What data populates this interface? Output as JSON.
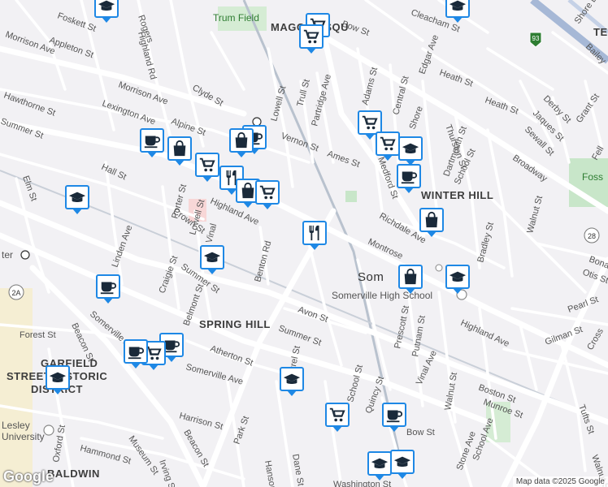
{
  "map": {
    "attribution": "Map data ©2025 Google",
    "logo": "Google",
    "neighborhoods": [
      {
        "id": "magoun-square",
        "text": "MAGOUN SQU"
      },
      {
        "id": "winter-hill",
        "text": "WINTER HILL"
      },
      {
        "id": "spring-hill",
        "text": "SPRING HILL"
      },
      {
        "id": "baldwin",
        "text": "BALDWIN"
      },
      {
        "id": "garfield-1",
        "text": "GARFIELD"
      },
      {
        "id": "garfield-2",
        "text": "STREET HISTORIC"
      },
      {
        "id": "garfield-3",
        "text": "DISTRICT"
      },
      {
        "id": "ten-hills",
        "text": "TE"
      },
      {
        "id": "foss",
        "text": "Foss"
      }
    ],
    "places": [
      {
        "id": "trum-field",
        "text": "Trum Field"
      },
      {
        "id": "somerville",
        "text": "Som"
      },
      {
        "id": "somerville-high",
        "text": "Somerville High School"
      },
      {
        "id": "lesley-1",
        "text": "Lesley"
      },
      {
        "id": "lesley-2",
        "text": "University"
      },
      {
        "id": "porter-station",
        "text": "ter"
      }
    ],
    "streets": [
      "Foskett St",
      "Rogers",
      "Highland Rd",
      "Appleton St",
      "Morrison Ave",
      "Bow St",
      "Cleacham St",
      "Edgar Ave",
      "Heath St",
      "Shore Dr",
      "Bailey",
      "Morrison Ave",
      "Clyde St",
      "Lowell St",
      "Trull St",
      "Partridge Ave",
      "Hawthorne St",
      "Lexington Ave",
      "Alpine St",
      "Vernon St",
      "Adams St",
      "Central St",
      "Ames St",
      "Medford St",
      "Shore",
      "Thurston St",
      "Dartmouth St",
      "School St",
      "Heath St",
      "Derby St",
      "Jaques St",
      "Sewall St",
      "Grant St",
      "Broadway",
      "Summer St",
      "Elm St",
      "Hall St",
      "Porter St",
      "Lowell St",
      "Vinal",
      "Crown St",
      "Highland Ave",
      "Richdale Ave",
      "Montrose",
      "Walnut St",
      "Bradley St",
      "Linden Ave",
      "Craigie St",
      "Summer St",
      "Belmont St",
      "Benton Rd",
      "Avon St",
      "Somerville Ave",
      "Beacon St",
      "Forest St",
      "Atherton St",
      "Summer St",
      "Laurel St",
      "Somerville Ave",
      "School St",
      "Quincy St",
      "Prescott St",
      "Putnam St",
      "Vinal Ave",
      "Highland Ave",
      "Walnut St",
      "Boston St",
      "Munroe St",
      "School Ave",
      "Stone Ave",
      "Pearl St",
      "Gilman St",
      "Cross",
      "Tufts St",
      "Otis St",
      "Bona",
      "Harrison St",
      "Museum St",
      "Hammond St",
      "Oxford St",
      "Beacon St",
      "Park St",
      "Irving St",
      "Dane St",
      "Hanson",
      "Bow St",
      "Washington St",
      "Walnut St",
      "Fell"
    ],
    "routes": [
      "93",
      "28",
      "2A"
    ],
    "markers": [
      {
        "type": "school",
        "icon": "school-icon"
      },
      {
        "type": "grocery",
        "icon": "cart-icon"
      },
      {
        "type": "grocery",
        "icon": "cart-icon"
      },
      {
        "type": "school",
        "icon": "school-icon"
      },
      {
        "type": "grocery",
        "icon": "cart-icon"
      },
      {
        "type": "cafe",
        "icon": "cafe-icon"
      },
      {
        "type": "cafe",
        "icon": "cafe-icon"
      },
      {
        "type": "store",
        "icon": "shopping-bag-icon"
      },
      {
        "type": "store",
        "icon": "shopping-bag-icon"
      },
      {
        "type": "grocery",
        "icon": "cart-icon"
      },
      {
        "type": "grocery",
        "icon": "cart-icon"
      },
      {
        "type": "school",
        "icon": "school-icon"
      },
      {
        "type": "restaurant",
        "icon": "restaurant-icon"
      },
      {
        "type": "store",
        "icon": "shopping-bag-icon"
      },
      {
        "type": "grocery",
        "icon": "cart-icon"
      },
      {
        "type": "cafe",
        "icon": "cafe-icon"
      },
      {
        "type": "school",
        "icon": "school-icon"
      },
      {
        "type": "store",
        "icon": "shopping-bag-icon"
      },
      {
        "type": "restaurant",
        "icon": "restaurant-icon"
      },
      {
        "type": "school",
        "icon": "school-icon"
      },
      {
        "type": "store",
        "icon": "shopping-bag-icon"
      },
      {
        "type": "school",
        "icon": "school-icon"
      },
      {
        "type": "cafe",
        "icon": "cafe-icon"
      },
      {
        "type": "cafe",
        "icon": "cafe-icon"
      },
      {
        "type": "grocery",
        "icon": "cart-icon"
      },
      {
        "type": "cafe",
        "icon": "cafe-icon"
      },
      {
        "type": "school",
        "icon": "school-icon"
      },
      {
        "type": "school",
        "icon": "school-icon"
      },
      {
        "type": "grocery",
        "icon": "cart-icon"
      },
      {
        "type": "cafe",
        "icon": "cafe-icon"
      },
      {
        "type": "school",
        "icon": "school-icon"
      },
      {
        "type": "school",
        "icon": "school-icon"
      }
    ],
    "colors": {
      "background": "#f2f1f4",
      "road": "#ffffff",
      "major_road": "#fdfdfd",
      "park": "#c8e6c9",
      "marker_border": "#1e88e5",
      "marker_icon": "#1a2a3a",
      "rail": "#b0b7c3",
      "highway": "#a6b8d6"
    }
  }
}
